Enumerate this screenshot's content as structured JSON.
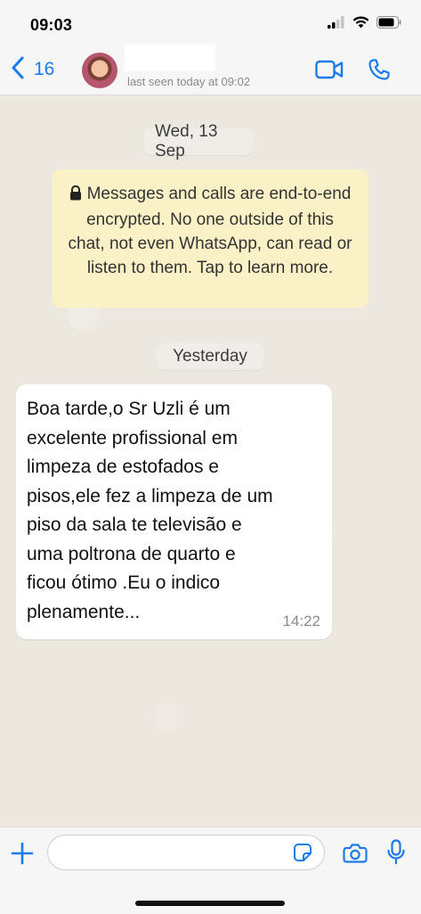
{
  "status_bar": {
    "time": "09:03",
    "icons": [
      "cellular-signal-icon",
      "wifi-icon",
      "battery-icon"
    ]
  },
  "header": {
    "back_count": "16",
    "last_seen": "last seen today at 09:02",
    "icons": [
      "chevron-left-icon",
      "video-camera-icon",
      "phone-icon"
    ]
  },
  "chat": {
    "date_1": "Wed, 13 Sep",
    "encryption_notice": "Messages and calls are end-to-end encrypted. No one outside of this chat, not even WhatsApp, can read or listen to them. Tap to learn more.",
    "date_2": "Yesterday",
    "messages": [
      {
        "text": "Boa tarde,o Sr Uzli é um\nexcelente profissional em\nlimpeza de estofados e\npisos,ele fez a limpeza de um\npiso da sala te televisão e\numa poltrona de quarto e\nficou ótimo .Eu o indico\nplenamente...",
        "time": "14:22"
      }
    ]
  },
  "input_bar": {
    "placeholder": "",
    "icons": [
      "plus-icon",
      "sticker-icon",
      "camera-icon",
      "microphone-icon"
    ]
  },
  "colors": {
    "accent": "#1a7bea",
    "chat_background": "#ece7df",
    "notice_background": "#fbf1c6",
    "bubble_background": "#ffffff"
  }
}
